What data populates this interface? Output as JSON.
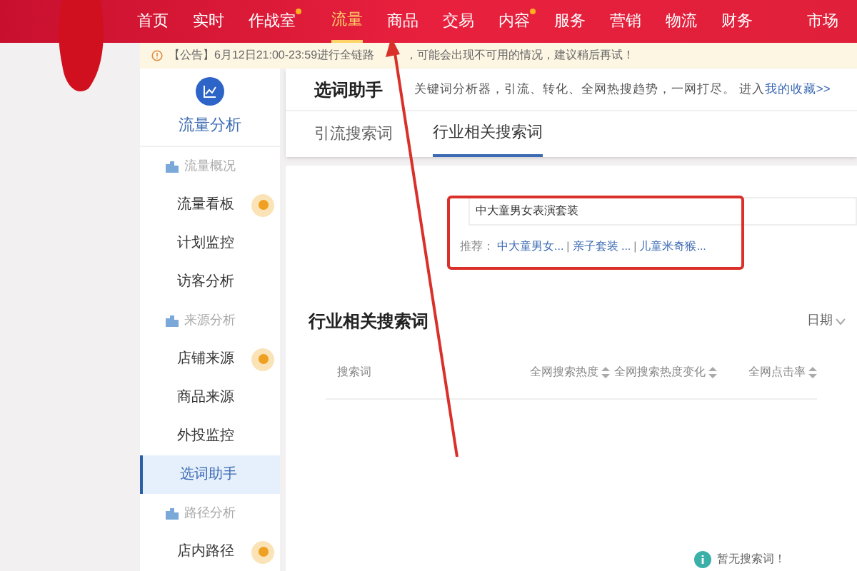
{
  "nav": {
    "items": [
      {
        "label": "首页",
        "selected": false,
        "dot": false
      },
      {
        "label": "实时",
        "selected": false,
        "dot": false
      },
      {
        "label": "作战室",
        "selected": false,
        "dot": true
      },
      {
        "label": "流量",
        "selected": true,
        "dot": false
      },
      {
        "label": "商品",
        "selected": false,
        "dot": false
      },
      {
        "label": "交易",
        "selected": false,
        "dot": false
      },
      {
        "label": "内容",
        "selected": false,
        "dot": true
      },
      {
        "label": "服务",
        "selected": false,
        "dot": false
      },
      {
        "label": "营销",
        "selected": false,
        "dot": false
      },
      {
        "label": "物流",
        "selected": false,
        "dot": false
      },
      {
        "label": "财务",
        "selected": false,
        "dot": false
      },
      {
        "label": "市场",
        "selected": false,
        "dot": false
      }
    ]
  },
  "notice": {
    "text_before": "【公告】6月12日21:00-23:59进行全链路",
    "text_after": "，可能会出现不可用的情况，建议稍后再试！"
  },
  "sidebar": {
    "title": "流量分析",
    "sections": [
      {
        "label": "流量概况",
        "items": [
          {
            "label": "流量看板",
            "selected": false,
            "dot": true
          },
          {
            "label": "计划监控",
            "selected": false,
            "dot": false
          },
          {
            "label": "访客分析",
            "selected": false,
            "dot": false
          }
        ]
      },
      {
        "label": "来源分析",
        "items": [
          {
            "label": "店铺来源",
            "selected": false,
            "dot": true
          },
          {
            "label": "商品来源",
            "selected": false,
            "dot": false
          },
          {
            "label": "外投监控",
            "selected": false,
            "dot": false
          },
          {
            "label": "选词助手",
            "selected": true,
            "dot": false
          }
        ]
      },
      {
        "label": "路径分析",
        "items": [
          {
            "label": "店内路径",
            "selected": false,
            "dot": true
          }
        ]
      }
    ]
  },
  "header": {
    "title": "选词助手",
    "description": "关键词分析器，引流、转化、全网热搜趋势，一网打尽。 进入",
    "link": "我的收藏>>"
  },
  "tabs": [
    {
      "label": "引流搜索词",
      "selected": false
    },
    {
      "label": "行业相关搜索词",
      "selected": true
    }
  ],
  "search": {
    "value": "中大童男女表演套装",
    "suggestions_label": "推荐：",
    "suggestions": [
      "中大童男女...",
      "亲子套装 ...",
      "儿童米奇猴..."
    ],
    "separators": [
      "|",
      "|"
    ]
  },
  "section": {
    "title": "行业相关搜索词",
    "date_filter": "日期"
  },
  "table": {
    "columns": [
      {
        "label": "搜索词",
        "sortable": false
      },
      {
        "label": "全网搜索热度",
        "sortable": true
      },
      {
        "label": "全网搜索热度变化",
        "sortable": true
      },
      {
        "label": "全网点击率",
        "sortable": true
      }
    ]
  },
  "empty_state": {
    "text": "暂无搜索词！"
  }
}
